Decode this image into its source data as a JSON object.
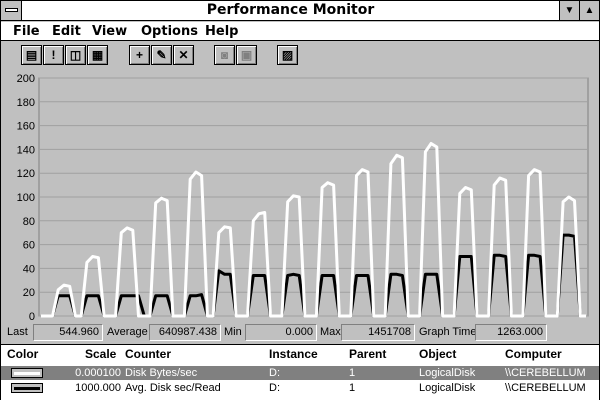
{
  "window": {
    "title": "Performance Monitor",
    "sys_menu_icon": "system-menu-icon",
    "minimize_glyph": "▼",
    "maximize_glyph": "▲"
  },
  "menu": {
    "items": [
      "File",
      "Edit",
      "View",
      "Options",
      "Help"
    ]
  },
  "toolbar": {
    "buttons": [
      {
        "name": "chart-view-icon",
        "glyph": "▤",
        "enabled": true
      },
      {
        "name": "alert-view-icon",
        "glyph": "!",
        "enabled": true
      },
      {
        "name": "log-view-icon",
        "glyph": "◫",
        "enabled": true
      },
      {
        "name": "report-view-icon",
        "glyph": "▦",
        "enabled": true
      },
      {
        "name": "add-counter-icon",
        "glyph": "+",
        "enabled": true
      },
      {
        "name": "edit-counter-icon",
        "glyph": "✎",
        "enabled": true
      },
      {
        "name": "delete-counter-icon",
        "glyph": "✕",
        "enabled": true
      },
      {
        "name": "update-now-icon",
        "glyph": "◙",
        "enabled": false
      },
      {
        "name": "bookmark-icon",
        "glyph": "▣",
        "enabled": false
      },
      {
        "name": "options-icon",
        "glyph": "▨",
        "enabled": true
      }
    ]
  },
  "stats": {
    "last_label": "Last",
    "last_value": "544.960",
    "average_label": "Average",
    "average_value": "640987.438",
    "min_label": "Min",
    "min_value": "0.000",
    "max_label": "Max",
    "max_value": "1451708",
    "graph_time_label": "Graph Time",
    "graph_time_value": "1263.000"
  },
  "legend": {
    "headers": {
      "color": "Color",
      "scale": "Scale",
      "counter": "Counter",
      "instance": "Instance",
      "parent": "Parent",
      "object": "Object",
      "computer": "Computer"
    },
    "rows": [
      {
        "color": "#ffffff",
        "scale": "0.000100",
        "counter": "Disk Bytes/sec",
        "instance": "D:",
        "parent": "1",
        "object": "LogicalDisk",
        "computer": "\\\\CEREBELLUM",
        "selected": true
      },
      {
        "color": "#000000",
        "scale": "1000.000",
        "counter": "Avg. Disk sec/Read",
        "instance": "D:",
        "parent": "1",
        "object": "LogicalDisk",
        "computer": "\\\\CEREBELLUM",
        "selected": false
      }
    ]
  },
  "chart_data": {
    "type": "line",
    "ylim": [
      0,
      200
    ],
    "yticks": [
      0,
      20,
      40,
      60,
      80,
      100,
      120,
      140,
      160,
      180,
      200
    ],
    "grid": true,
    "series": [
      {
        "name": "Disk Bytes/sec",
        "color": "#ffffff",
        "values": [
          0,
          0,
          0,
          22,
          26,
          25,
          0,
          0,
          45,
          50,
          49,
          0,
          0,
          0,
          70,
          74,
          72,
          0,
          0,
          0,
          95,
          99,
          97,
          0,
          0,
          0,
          115,
          121,
          118,
          0,
          0,
          70,
          75,
          74,
          0,
          0,
          0,
          80,
          86,
          87,
          0,
          0,
          0,
          96,
          101,
          100,
          0,
          0,
          0,
          108,
          112,
          110,
          0,
          0,
          0,
          118,
          123,
          121,
          0,
          0,
          0,
          128,
          135,
          133,
          0,
          0,
          0,
          138,
          145,
          142,
          0,
          0,
          0,
          103,
          108,
          106,
          0,
          0,
          0,
          110,
          116,
          114,
          0,
          0,
          0,
          118,
          123,
          121,
          0,
          0,
          0,
          96,
          100,
          97,
          0,
          0
        ]
      },
      {
        "name": "Avg. Disk sec/Read",
        "color": "#000000",
        "values": [
          0,
          0,
          0,
          17,
          17,
          17,
          0,
          0,
          17,
          17,
          17,
          0,
          0,
          0,
          17,
          17,
          17,
          17,
          0,
          0,
          17,
          17,
          17,
          0,
          0,
          0,
          17,
          17,
          18,
          0,
          0,
          38,
          35,
          35,
          0,
          0,
          0,
          34,
          34,
          34,
          0,
          0,
          0,
          34,
          35,
          34,
          0,
          0,
          0,
          34,
          34,
          34,
          0,
          0,
          0,
          34,
          34,
          34,
          0,
          0,
          0,
          35,
          35,
          34,
          0,
          0,
          0,
          35,
          35,
          35,
          0,
          0,
          0,
          50,
          50,
          50,
          0,
          0,
          0,
          51,
          51,
          50,
          0,
          0,
          0,
          51,
          51,
          50,
          0,
          0,
          0,
          68,
          68,
          67,
          0,
          0
        ]
      }
    ]
  }
}
